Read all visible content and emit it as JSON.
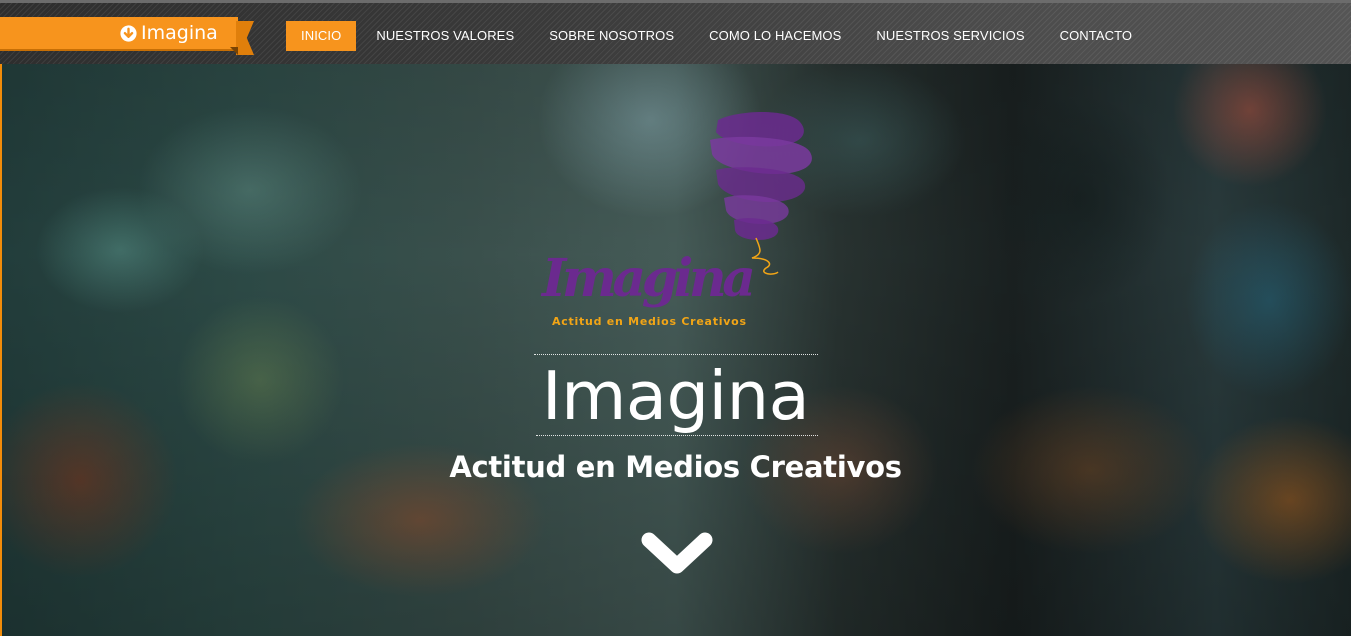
{
  "brand": {
    "name": "Imagina",
    "icon": "circle-arrow-down-icon",
    "color": "#f7941d"
  },
  "nav": {
    "items": [
      {
        "label": "INICIO",
        "active": true
      },
      {
        "label": "NUESTROS VALORES",
        "active": false
      },
      {
        "label": "SOBRE NOSOTROS",
        "active": false
      },
      {
        "label": "COMO LO HACEMOS",
        "active": false
      },
      {
        "label": "NUESTROS SERVICIOS",
        "active": false
      },
      {
        "label": "CONTACTO",
        "active": false
      }
    ]
  },
  "hero": {
    "logo_wordmark": "Imagina",
    "logo_tagline": "Actitud en Medios Creativos",
    "title": "Imagina",
    "subtitle": "Actitud en Medios Creativos",
    "scroll_icon": "chevron-down-icon"
  },
  "colors": {
    "accent": "#f7941d",
    "logo_purple": "#6b2a8f",
    "logo_tagline": "#f2a516"
  }
}
